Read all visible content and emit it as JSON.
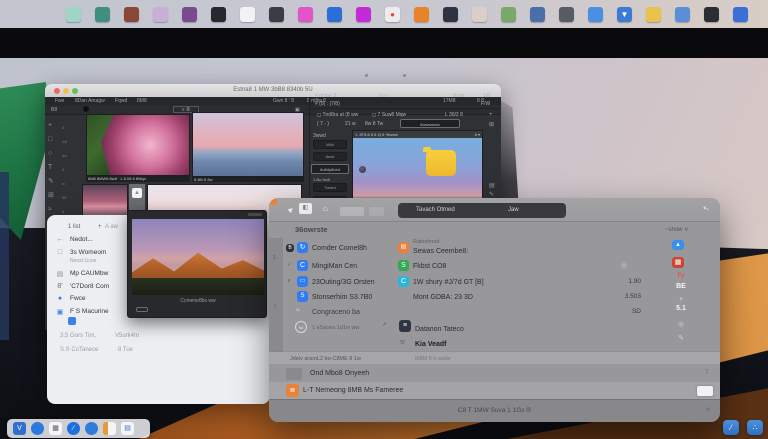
{
  "desktop": {
    "top_apps": [
      {
        "name": "app-grid-teal",
        "color": "#9fd4c6",
        "glyph": ""
      },
      {
        "name": "app-green",
        "color": "#3f8f7f",
        "glyph": ""
      },
      {
        "name": "app-photo-red",
        "color": "#8a4636",
        "glyph": ""
      },
      {
        "name": "app-grid-pink",
        "color": "#c9aed6",
        "glyph": ""
      },
      {
        "name": "app-purple-circle",
        "color": "#7a4a8f",
        "glyph": ""
      },
      {
        "name": "app-black",
        "color": "#26282e",
        "glyph": ""
      },
      {
        "name": "app-notes",
        "color": "#f2f2f4",
        "glyph": ""
      },
      {
        "name": "app-vinyl",
        "color": "#3a3d45",
        "glyph": ""
      },
      {
        "name": "app-magenta-chart",
        "color": "#e255c8",
        "glyph": ""
      },
      {
        "name": "app-blue-q",
        "color": "#2a6fd6",
        "glyph": ""
      },
      {
        "name": "app-purple-f",
        "color": "#c32bd9",
        "glyph": ""
      },
      {
        "name": "app-white-dot",
        "color": "#ededef",
        "glyph": "●"
      },
      {
        "name": "app-orange",
        "color": "#e8832a",
        "glyph": ""
      },
      {
        "name": "app-dark-photo",
        "color": "#2f3240",
        "glyph": ""
      },
      {
        "name": "app-photos",
        "color": "#d8cfc6",
        "glyph": ""
      },
      {
        "name": "app-green-white",
        "color": "#7aa86a",
        "glyph": ""
      },
      {
        "name": "app-blue-image",
        "color": "#4a6fa8",
        "glyph": ""
      },
      {
        "name": "app-gray-image",
        "color": "#585b63",
        "glyph": ""
      },
      {
        "name": "app-bubble",
        "color": "#4a90e2",
        "glyph": ""
      },
      {
        "name": "app-blue-v",
        "color": "#3a7bd5",
        "glyph": "▼"
      },
      {
        "name": "app-folder",
        "color": "#e8c24a",
        "glyph": ""
      },
      {
        "name": "app-blue-doc",
        "color": "#5a8fd8",
        "glyph": ""
      },
      {
        "name": "app-dark-book",
        "color": "#2a2d34",
        "glyph": ""
      },
      {
        "name": "app-blue-door",
        "color": "#3a6fd8",
        "glyph": ""
      }
    ],
    "dock_items": [
      {
        "name": "dock-doc-v",
        "color": "#2f6fd0",
        "glyph": "V",
        "round": false
      },
      {
        "name": "dock-globe",
        "color": "#2a7ae0",
        "glyph": "",
        "round": true
      },
      {
        "name": "dock-grid",
        "color": "#f5f5f7",
        "glyph": "▦",
        "round": false,
        "fg": "#55585f"
      },
      {
        "name": "dock-compass",
        "color": "#1f6fe0",
        "glyph": "∕",
        "round": true
      },
      {
        "name": "dock-sphere",
        "color": "#2f7cd6",
        "glyph": "",
        "round": true
      },
      {
        "name": "dock-bars",
        "color": "linear-gradient(90deg,#e89a3a 0 40%,#f5f5f7 40% 100%)",
        "glyph": "",
        "round": false
      },
      {
        "name": "dock-text-doc",
        "color": "#f5f5f7",
        "glyph": "▤",
        "round": false,
        "fg": "#3a6fd8"
      }
    ],
    "corner_icons": [
      {
        "name": "corner-pen",
        "glyph": "∕"
      },
      {
        "name": "corner-dots",
        "glyph": "∴"
      }
    ]
  },
  "editor_window": {
    "title": "Estna8 1 MW 3bB8 8340b 5U",
    "menu_left": [
      "Fwe",
      "8Dan Amagw",
      "Fqwd",
      "8M8"
    ],
    "menu_right": [
      "Gwn 8 ' 8",
      "8 m8w 8"
    ],
    "menu_far": [
      "17M8",
      "8 8"
    ],
    "options_chip": "B8",
    "options_grid": "≡ ≣",
    "options_right": "▣",
    "tools": [
      {
        "g": "+",
        "l": "8"
      },
      {
        "g": "□",
        "l": "w8"
      },
      {
        "g": "○",
        "l": "8w"
      },
      {
        "g": "T",
        "l": "8"
      },
      {
        "g": "✎",
        "l": "w"
      },
      {
        "g": "⊞",
        "l": "88"
      },
      {
        "g": "≈",
        "l": "8"
      },
      {
        "g": "◇",
        "l": "w8"
      },
      {
        "g": "Z",
        "l": "8"
      },
      {
        "g": "#",
        "l": "8w"
      },
      {
        "g": "(",
        "l": "8"
      },
      {
        "g": "a",
        "l": ""
      }
    ],
    "caption_a": "8M8 8MW8 8w8 · L 8.08 8 8Mqn",
    "caption_b": "8 8M 8 8w",
    "panel_icon": "▲",
    "right_panel": {
      "header": "4 mooe 3",
      "header_mid": "· 8ww ·",
      "header_right": "8 ran",
      "header_far": "1/8",
      "row2": "# (8) : (7/8)",
      "row2_right": "F/W",
      "check1": "◻ Tnd8ra at (8 ww",
      "check2": "◻ 7 Suw8 Mqw",
      "opt_right": "L 30/2 8",
      "slider1": "( 7 · )",
      "slider2": "21 w",
      "slider3": "8w 8 Tw",
      "input_text": "8wwwwww",
      "col_label": "3wwd",
      "btn1": "M8d",
      "btn2": "8wrd",
      "input_hl": "8o8dy8hed",
      "col_tiny": "1.8w 8w8",
      "btn3": "Twwrd",
      "btn4": "8M8",
      "subwindow_title": "1. 8T8:8 8 8 4) 8 *8www",
      "subwindow_right": "8 ▾",
      "strip": [
        "+",
        "⊞",
        "▤",
        "✎"
      ]
    },
    "float_window": {
      "caption": "Ccmene8bs ww"
    }
  },
  "files_panel": {
    "header": "1 list",
    "header_plus": "+",
    "header_right": "A aw",
    "items": [
      {
        "icon": "←",
        "icon_color": "#3b82e8",
        "label": "Nedot..."
      },
      {
        "icon": "□",
        "icon_color": "#8a8d94",
        "label": "3s Womeom",
        "sub": "Nenst Licne"
      },
      {
        "icon": "▤",
        "icon_color": "#8a8d94",
        "label": "Mp CAUMbw"
      },
      {
        "icon": "8'",
        "icon_color": "#6a6d74",
        "label": "'C7Dor8 Com"
      },
      {
        "icon": "●",
        "icon_color": "#3b82e8",
        "label": "Fwce"
      },
      {
        "icon": "▣",
        "icon_color": "#3b82e8",
        "label": "F S Macurine"
      }
    ],
    "footer1a": "3.5 Gors Tim,",
    "footer1b": "V5urk4m",
    "footer2a": "S.S CoTanece",
    "footer2b": "8 Tue"
  },
  "search_window": {
    "toolbar": {
      "tab1": "Tavach Otmed",
      "tab2": "Jaw"
    },
    "header": "36owrste",
    "header_right": "~show ∨",
    "gutter_marks": [
      "1",
      "❘"
    ],
    "rows": [
      {
        "prefix": "B",
        "icon": "↻",
        "icon_color": "#2f7cf6",
        "label": "Comder Comel8h",
        "icon2": "▤",
        "icon2_color": "#ef7d3b",
        "sub_top": "Rainshnod",
        "label2": "Sewas Ceembe8:"
      },
      {
        "prefix": "✓",
        "icon": "C",
        "icon_color": "#2f7cf6",
        "label": "MingiMan Cen",
        "icon2": "S",
        "icon2_color": "#34a853",
        "label2": "Fkbst CO8",
        "mid": "◎"
      },
      {
        "prefix": "∨",
        "icon": "▭",
        "icon_color": "#2f7cf6",
        "label": "23Outing/3G Orsten",
        "icon2": "C",
        "icon2_color": "#29b6d8",
        "label2": "1W shury #J/7d GT [B]",
        "value": "1.90"
      },
      {
        "icon": "S",
        "icon_color": "#2f7cf6",
        "label": "Stonserhim S3.7B0",
        "label2": "Mont GDBA: 23 3D",
        "value": "3.503"
      },
      {
        "icon": "≈",
        "label": "Congraceno ba",
        "value": "SD"
      },
      {
        "ring": "6d",
        "label": "1 eSaoes 1d1w ww",
        "arrow": "↗",
        "icon2": "≡",
        "icon2_color": "#2e3440",
        "label2": "Datanon Tateco"
      },
      {
        "glyph2": "∇/",
        "label2": "Kia Veadf"
      }
    ],
    "right_icons": [
      {
        "kind": "chip",
        "color": "#3a8fe8",
        "glyph": "▲"
      },
      {
        "kind": "chip",
        "color": "#cc4633",
        "glyph": "▦"
      },
      {
        "kind": "text",
        "text": "Fy",
        "color": "#e05545"
      },
      {
        "kind": "text",
        "text": "BE",
        "color": "#f5f5f7"
      },
      {
        "kind": "text",
        "text": "+",
        "color": "#e8e8ec"
      },
      {
        "kind": "text",
        "text": "5.1",
        "color": "#f5f5f7"
      },
      {
        "kind": "text",
        "text": "◎",
        "color": "#d5d5da"
      },
      {
        "kind": "text",
        "text": "✎",
        "color": "#d5d5da"
      }
    ],
    "section_left": "Jdelv aramL2 bo-C8ME 8 1w",
    "section_right": "M8M 8 b wwbr",
    "row_a_label": "Ond Mbo8 Onyeeh",
    "row_a_right": "7",
    "row_b_label": "L-T Nemeong 8MB Ms Fameree",
    "status_text": "C8 T 1MW Suva 1 1Gs ®",
    "status_close": "✕"
  }
}
